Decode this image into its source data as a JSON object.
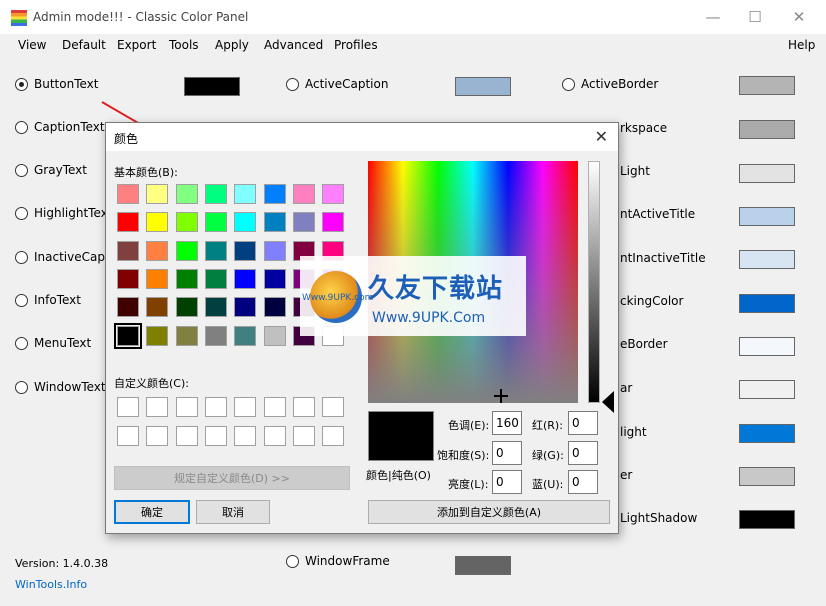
{
  "app": {
    "title": "Admin mode!!! - Classic Color Panel",
    "minimize": "—",
    "maximize": "☐",
    "close": "✕"
  },
  "menu": [
    "View",
    "Default",
    "Export",
    "Tools",
    "Apply",
    "Advanced",
    "Profiles"
  ],
  "help": "Help",
  "col1": [
    {
      "label": "ButtonText",
      "selected": true
    },
    {
      "label": "CaptionText",
      "selected": false
    },
    {
      "label": "GrayText",
      "selected": false
    },
    {
      "label": "HighlightText",
      "selected": false
    },
    {
      "label": "InactiveCaptio",
      "selected": false
    },
    {
      "label": "InfoText",
      "selected": false
    },
    {
      "label": "MenuText",
      "selected": false
    },
    {
      "label": "WindowText",
      "selected": false
    }
  ],
  "col1_swatch_color": "#000000",
  "col2_top": {
    "label": "ActiveCaption",
    "color": "#99b4d1"
  },
  "col2_bottom": {
    "label": "WindowFrame",
    "color": "#646464"
  },
  "col3_top": {
    "label": "ActiveBorder",
    "color": "#b4b4b4"
  },
  "col3_partial": [
    {
      "label": "rkspace",
      "color": "#ababab"
    },
    {
      "label": "Light",
      "color": "#e3e3e3"
    },
    {
      "label": "ntActiveTitle",
      "color": "#b9d1ea"
    },
    {
      "label": "ntInactiveTitle",
      "color": "#d7e4f2"
    },
    {
      "label": "ckingColor",
      "color": "#0066cc"
    },
    {
      "label": "eBorder",
      "color": "#f4f7fc"
    },
    {
      "label": "ar",
      "color": "#f0f0f0"
    },
    {
      "label": "light",
      "color": "#0078d7"
    },
    {
      "label": "er",
      "color": "#c8c8c8"
    },
    {
      "label": "LightShadow",
      "color": "#000000"
    }
  ],
  "footer": {
    "version": "Version: 1.4.0.38",
    "site": "WinTools.Info"
  },
  "dialog": {
    "title": "颜色",
    "close": "✕",
    "basic_label": "基本颜色(B):",
    "custom_label": "自定义颜色(C):",
    "define_custom": "规定自定义颜色(D) >>",
    "ok": "确定",
    "cancel": "取消",
    "solid_label": "颜色|纯色(O)",
    "add_custom": "添加到自定义颜色(A)",
    "hue_label": "色调(E):",
    "hue": "160",
    "sat_label": "饱和度(S):",
    "sat": "0",
    "lum_label": "亮度(L):",
    "lum": "0",
    "red_label": "红(R):",
    "red": "0",
    "green_label": "绿(G):",
    "green": "0",
    "blue_label": "蓝(U):",
    "blue": "0",
    "basic_colors": [
      [
        "#ff8080",
        "#ffff80",
        "#80ff80",
        "#00ff80",
        "#80ffff",
        "#0080ff",
        "#ff80c0",
        "#ff80ff"
      ],
      [
        "#ff0000",
        "#ffff00",
        "#80ff00",
        "#00ff40",
        "#00ffff",
        "#0080c0",
        "#8080c0",
        "#ff00ff"
      ],
      [
        "#804040",
        "#ff8040",
        "#00ff00",
        "#008080",
        "#004080",
        "#8080ff",
        "#800040",
        "#ff0080"
      ],
      [
        "#800000",
        "#ff8000",
        "#008000",
        "#008040",
        "#0000ff",
        "#0000a0",
        "#800080",
        "#8000ff"
      ],
      [
        "#400000",
        "#804000",
        "#004000",
        "#004040",
        "#000080",
        "#000040",
        "#400040",
        "#400080"
      ],
      [
        "#000000",
        "#808000",
        "#808040",
        "#808080",
        "#408080",
        "#c0c0c0",
        "#400040",
        "#ffffff"
      ]
    ]
  },
  "watermark": {
    "name": "久友下载站",
    "url": "Www.9UPK.Com",
    "small": "Www.9UPK.com"
  }
}
